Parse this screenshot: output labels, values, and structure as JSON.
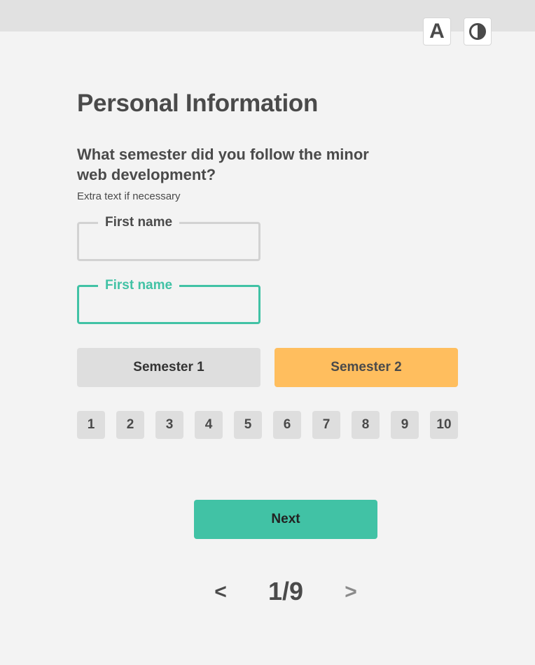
{
  "toolbar": {
    "font_button_label": "A",
    "font_button_icon": "font-size-icon",
    "contrast_button_icon": "contrast-icon"
  },
  "page": {
    "title": "Personal Information",
    "question": "What semester did you follow the minor web development?",
    "extra_text": "Extra text if necessary"
  },
  "fields": [
    {
      "label": "First name",
      "value": "",
      "state": "default"
    },
    {
      "label": "First name",
      "value": "",
      "state": "focused"
    }
  ],
  "semesters": [
    {
      "label": "Semester 1",
      "selected": false
    },
    {
      "label": "Semester 2",
      "selected": true
    }
  ],
  "numbers": [
    "1",
    "2",
    "3",
    "4",
    "5",
    "6",
    "7",
    "8",
    "9",
    "10"
  ],
  "next_button": {
    "label": "Next"
  },
  "pagination": {
    "prev_label": "<",
    "status": "1/9",
    "next_label": ">",
    "current": 1,
    "total": 9
  },
  "colors": {
    "accent": "#41c2a5",
    "selected": "#ffbe5e",
    "neutral_button": "#dedede",
    "text": "#4a4a4a",
    "background": "#f3f3f3"
  }
}
